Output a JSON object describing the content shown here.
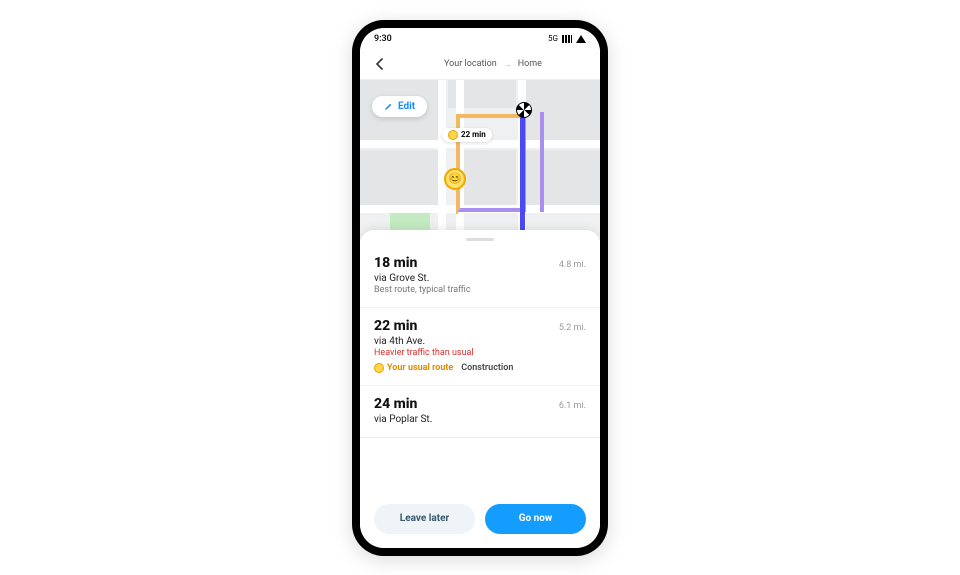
{
  "statusbar": {
    "time": "9:30",
    "network": "5G"
  },
  "header": {
    "from": "Your location",
    "to": "Home"
  },
  "map": {
    "edit_label": "Edit",
    "alt_time_badge": "22 min"
  },
  "routes": [
    {
      "duration": "18 min",
      "distance": "4.8 mi.",
      "via": "via Grove St.",
      "sub": "Best route, typical traffic",
      "warning": null,
      "usual_badge": null,
      "secondary_badge": null
    },
    {
      "duration": "22 min",
      "distance": "5.2 mi.",
      "via": "via 4th Ave.",
      "sub": null,
      "warning": "Heavier traffic than usual",
      "usual_badge": "Your usual route",
      "secondary_badge": "Construction"
    },
    {
      "duration": "24 min",
      "distance": "6.1 mi.",
      "via": "via Poplar St.",
      "sub": null,
      "warning": null,
      "usual_badge": null,
      "secondary_badge": null
    }
  ],
  "buttons": {
    "leave_later": "Leave later",
    "go_now": "Go now"
  },
  "colors": {
    "primary": "#149cff",
    "warning_text": "#d9302c",
    "usual_route": "#e08a00"
  }
}
